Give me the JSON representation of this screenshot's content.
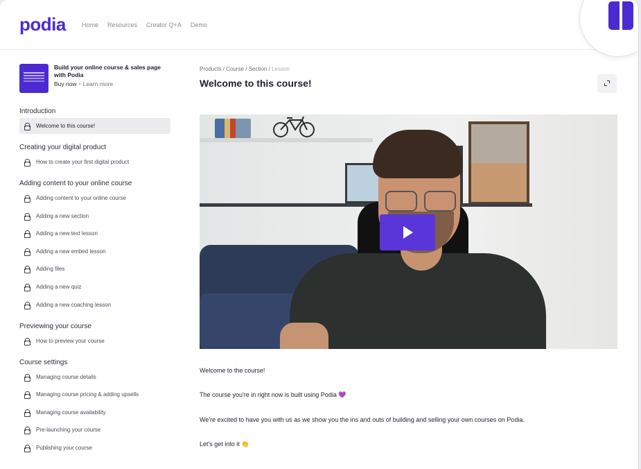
{
  "header": {
    "logo": "podia",
    "nav": [
      "Home",
      "Resources",
      "Creator Q+A",
      "Demo"
    ]
  },
  "product": {
    "title": "Build your online course & sales page with Podia",
    "buy": "Buy now",
    "separator": "•",
    "learn": "Learn more"
  },
  "sections": [
    {
      "title": "Introduction",
      "lessons": [
        "Welcome to this course!"
      ]
    },
    {
      "title": "Creating your digital product",
      "lessons": [
        "How to create your first digital product"
      ]
    },
    {
      "title": "Adding content to your online course",
      "lessons": [
        "Adding content to your online course",
        "Adding a new section",
        "Adding a new text lesson",
        "Adding a new embed lesson",
        "Adding files",
        "Adding a new quiz",
        "Adding a new coaching lesson"
      ]
    },
    {
      "title": "Previewing your course",
      "lessons": [
        "How to preview your course"
      ]
    },
    {
      "title": "Course settings",
      "lessons": [
        "Managing course details",
        "Managing course pricing & adding upsells",
        "Managing course availability",
        "Pre-launching your course",
        "Publishing your course"
      ]
    }
  ],
  "breadcrumb": {
    "products": "Products",
    "course": "Course",
    "section": "Section",
    "lesson": "Lesson",
    "sep": " / "
  },
  "page_title": "Welcome to this course!",
  "body": [
    "Welcome to the course!",
    "The course you're in right now is built using Podia 💜",
    "We're excited to have you with us as we show you the ins and outs of building and selling your own courses on Podia.",
    "Let's get into it 👏"
  ],
  "colors": {
    "brand": "#4b2bd1",
    "play_button": "#5a35d9"
  },
  "icons": {
    "lesson": "lock-icon",
    "expand": "expand-icon",
    "play": "play-icon"
  }
}
